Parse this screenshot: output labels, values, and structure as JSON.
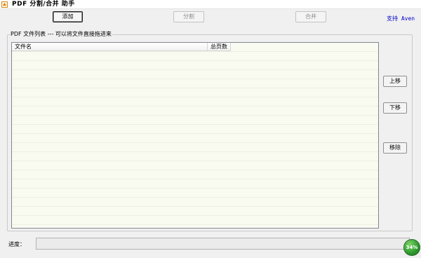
{
  "window": {
    "title": "PDF 分割/合并 助手"
  },
  "toolbar": {
    "add_label": "添加",
    "split_label": "分割",
    "merge_label": "合并",
    "support_label": "支持 Aven"
  },
  "file_group": {
    "legend": "PDF 文件列表  ---  可以将文件直接拖进来",
    "columns": [
      "文件名",
      "总页数"
    ]
  },
  "side_buttons": {
    "up_label": "上移",
    "down_label": "下移",
    "remove_label": "移除"
  },
  "progress": {
    "label": "进度：",
    "percent_text": "34%",
    "fraction": 0
  },
  "colors": {
    "support_link": "#0000c8",
    "list_background": "#f9faf0",
    "badge": "#2c9a2c"
  },
  "icons": {
    "app": "pdf-app-icon"
  }
}
